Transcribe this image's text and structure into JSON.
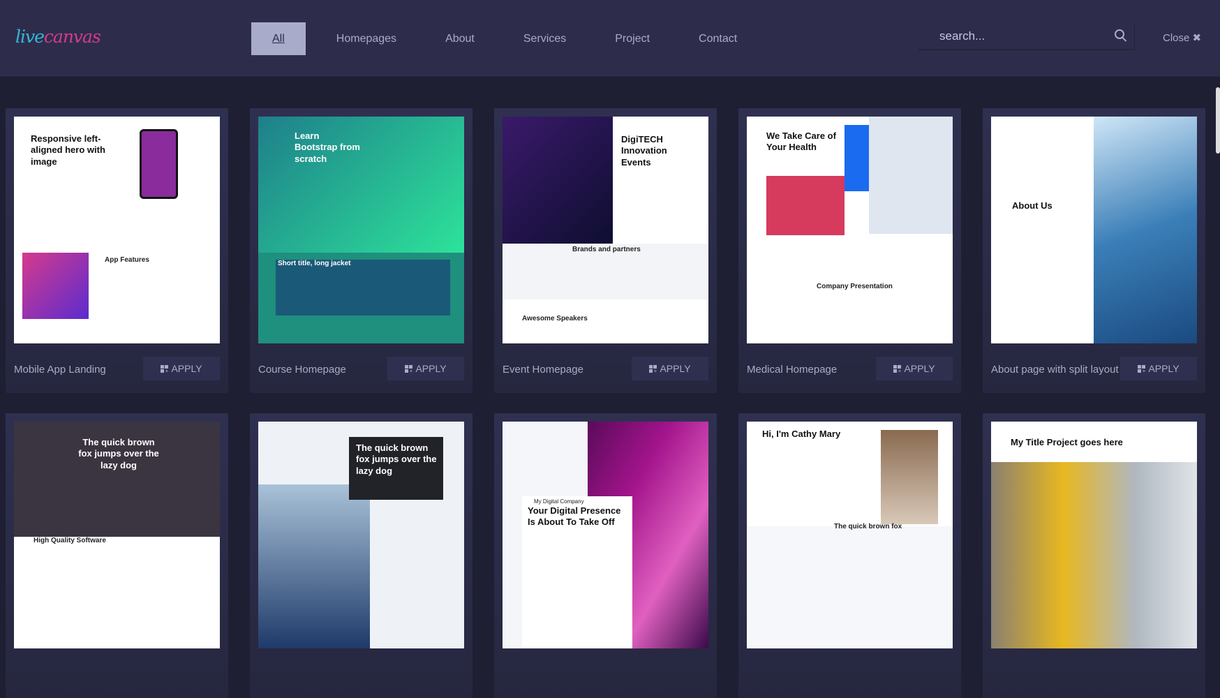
{
  "header": {
    "logo": {
      "part1": "live",
      "part2": "canvas"
    },
    "nav": [
      {
        "label": "All",
        "active": true
      },
      {
        "label": "Homepages"
      },
      {
        "label": "About"
      },
      {
        "label": "Services"
      },
      {
        "label": "Project"
      },
      {
        "label": "Contact"
      }
    ],
    "search": {
      "placeholder": "search...",
      "icon": "search-icon"
    },
    "close_label": "Close ✖"
  },
  "apply_label": "APPLY",
  "cards": [
    {
      "title": "Mobile App Landing",
      "headline": "Responsive left-aligned hero with image",
      "sub": "App Features",
      "bg": "#ffffff",
      "accent": "#8a2c9c"
    },
    {
      "title": "Course Homepage",
      "headline": "Learn Bootstrap from scratch",
      "sub": "Short title, long jacket",
      "bg": "#1f8f7e",
      "accent": "#2de39a"
    },
    {
      "title": "Event Homepage",
      "headline": "DigiTECH Innovation Events",
      "sub": "Brands and partners",
      "sub2": "Awesome Speakers",
      "bg": "#ffffff",
      "accent": "#1d1740"
    },
    {
      "title": "Medical Homepage",
      "headline": "We Take Care of Your Health",
      "sub": "Company Presentation",
      "bg": "#ffffff",
      "accent": "#1a6bf0"
    },
    {
      "title": "About page with split layout",
      "headline": "About Us",
      "bg": "#ffffff",
      "accent": "#3b7fb8"
    },
    {
      "headline": "The quick brown fox jumps over the lazy dog",
      "sub": "High Quality Software",
      "bg": "#3a3540",
      "accent": "#1a6bf0"
    },
    {
      "headline": "The quick brown fox jumps over the lazy dog",
      "bg": "#eef2f6",
      "accent": "#222328"
    },
    {
      "headline": "Your Digital Presence Is About To Take Off",
      "sub": "My Digital Company",
      "bg": "#f4f6f9",
      "accent": "#a3148c"
    },
    {
      "headline": "Hi, I'm Cathy Mary",
      "sub": "The quick brown fox",
      "bg": "#ffffff",
      "accent": "#8a6a50"
    },
    {
      "headline": "My Title Project goes here",
      "bg": "#ffffff",
      "accent": "#e8b820"
    }
  ]
}
